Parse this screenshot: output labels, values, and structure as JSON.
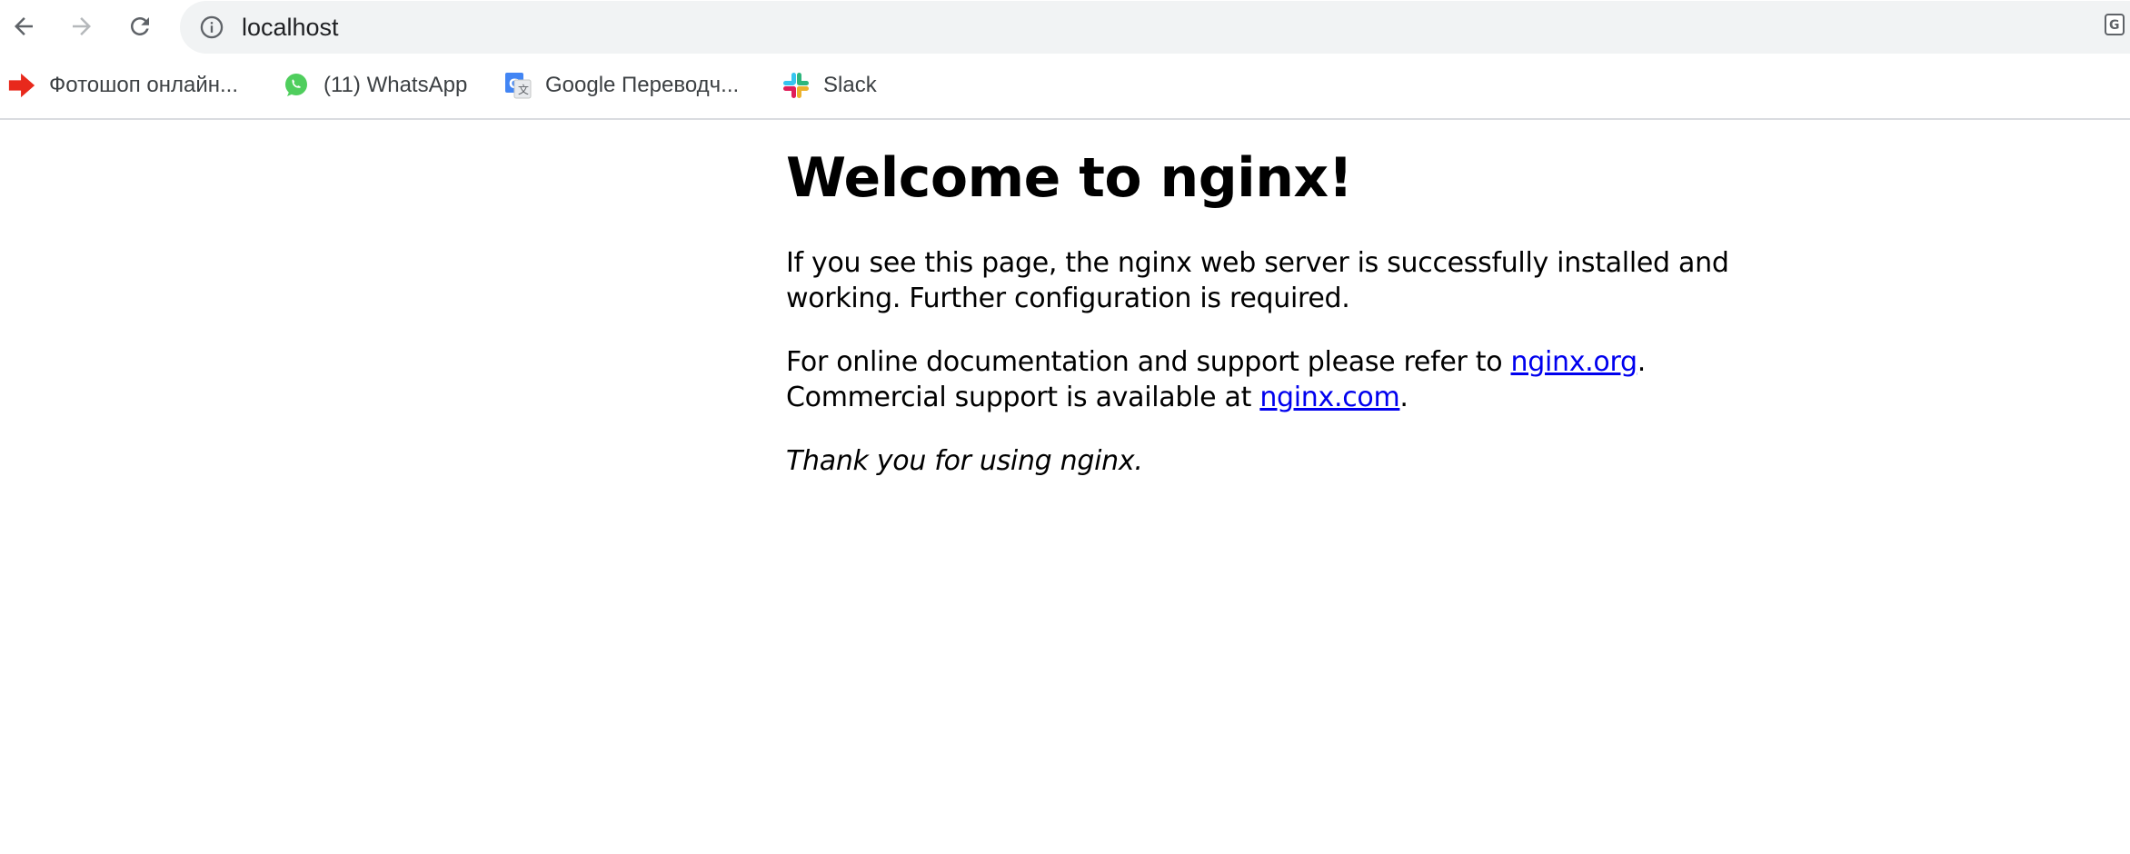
{
  "browser": {
    "url": "localhost",
    "nav": {
      "back_icon": "arrow-left-icon",
      "forward_icon": "arrow-right-icon",
      "reload_icon": "reload-icon"
    }
  },
  "bookmarks": [
    {
      "label": "Фотошоп онлайн...",
      "icon": "red-arrow-icon"
    },
    {
      "label": "(11) WhatsApp",
      "icon": "whatsapp-icon"
    },
    {
      "label": "Google Переводч...",
      "icon": "google-translate-icon"
    },
    {
      "label": "Slack",
      "icon": "slack-icon"
    }
  ],
  "page": {
    "heading": "Welcome to nginx!",
    "para1": "If you see this page, the nginx web server is successfully installed and working. Further configuration is required.",
    "para2_before": "For online documentation and support please refer to ",
    "link1": "nginx.org",
    "para2_mid": ".",
    "para2_line2": "Commercial support is available at ",
    "link2": "nginx.com",
    "para2_end": ".",
    "thanks": "Thank you for using nginx."
  },
  "colors": {
    "link": "#0000ee",
    "omnibox_bg": "#f1f3f4",
    "divider": "#dadce0"
  }
}
